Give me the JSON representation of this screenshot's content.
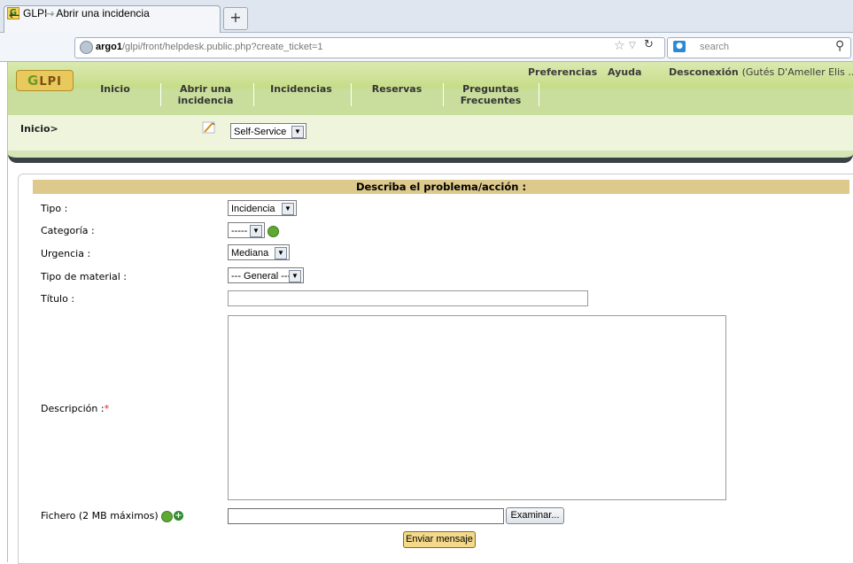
{
  "browser": {
    "tab_title": "GLPI - Abrir una incidencia",
    "new_tab": "+",
    "url_host": "argo1",
    "url_path": "/glpi/front/helpdesk.public.php?create_ticket=1",
    "search_placeholder": "search"
  },
  "header": {
    "logo_text": "LPI",
    "logo_g": "G",
    "preferences": "Preferencias",
    "help": "Ayuda",
    "logout": "Desconexión",
    "user": "(Gutés D'Ameller Elis ...)",
    "menu": [
      {
        "line1": "Inicio",
        "line2": ""
      },
      {
        "line1": "Abrir una",
        "line2": "incidencia"
      },
      {
        "line1": "Incidencias",
        "line2": ""
      },
      {
        "line1": "Reservas",
        "line2": ""
      },
      {
        "line1": "Preguntas",
        "line2": "Frecuentes"
      }
    ],
    "breadcrumb": "Inicio>",
    "profile_select": "Self-Service"
  },
  "form": {
    "title": "Describa el problema/acción :",
    "type_label": "Tipo :",
    "type_value": "Incidencia",
    "category_label": "Categoría :",
    "category_value": "-----",
    "urgency_label": "Urgencia :",
    "urgency_value": "Mediana",
    "material_label": "Tipo de material :",
    "material_value": "--- General ---",
    "title_label": "Título :",
    "description_label": "Descripción :",
    "required_mark": "*",
    "file_label": "Fichero (2 MB máximos) :",
    "browse_button": "Examinar...",
    "submit_button": "Enviar mensaje"
  },
  "colors": {
    "header_green": "#c9de9d",
    "form_header_gold": "#ddc98c",
    "submit_gold": "#f4d98a"
  }
}
